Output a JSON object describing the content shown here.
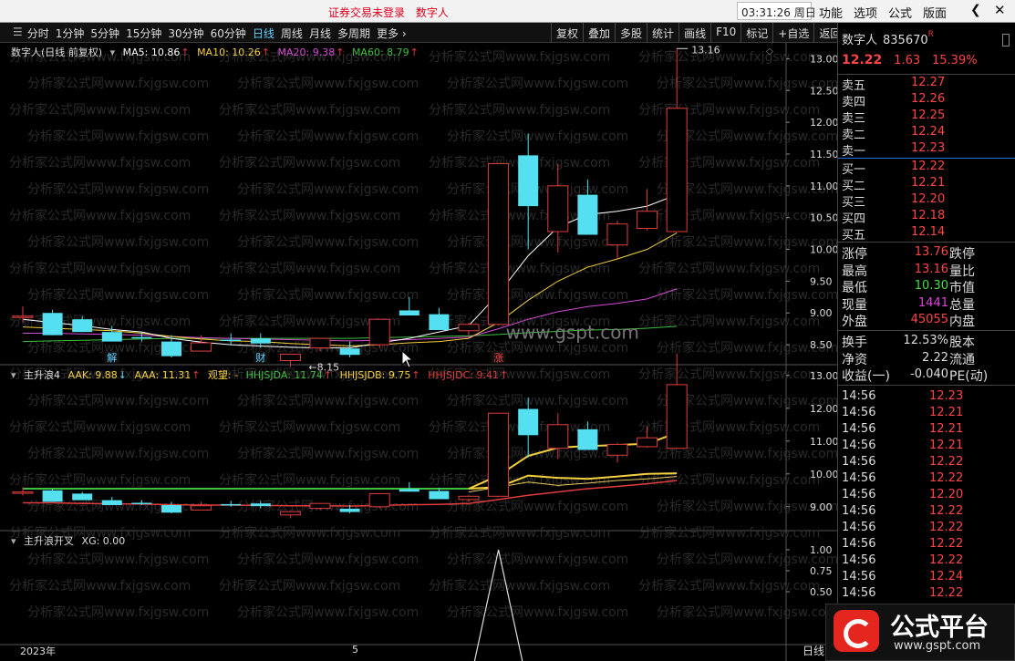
{
  "topbar": {
    "notice": "证券交易未登录",
    "stock_name": "数字人",
    "time": "03:31:26 周日",
    "menu": [
      "功能",
      "选项",
      "公式",
      "版面"
    ],
    "back_icon": "chevron-left-icon",
    "close_icon": "close-icon"
  },
  "toolbar": {
    "periods": [
      "分时",
      "1分钟",
      "5分钟",
      "15分钟",
      "30分钟",
      "60分钟",
      "日线",
      "周线",
      "月线",
      "多周期",
      "更多"
    ],
    "active_period": "日线",
    "tools": [
      "复权",
      "叠加",
      "多股",
      "统计",
      "画线",
      "F10",
      "标记",
      "+自选",
      "返回"
    ]
  },
  "main_panel": {
    "title": "数字人(日线 前复权)",
    "ma": [
      {
        "label": "MA5: 10.86",
        "color": "#ffffff"
      },
      {
        "label": "MA10: 10.26",
        "color": "#f4d03f"
      },
      {
        "label": "MA20: 9.38",
        "color": "#d24bd2"
      },
      {
        "label": "MA60: 8.79",
        "color": "#3fbf3f"
      }
    ],
    "annotations": {
      "high_label": "13.16",
      "low_label": "8.15",
      "watermark": "www.gspt.com",
      "marks": [
        "解",
        "财",
        "涨"
      ]
    }
  },
  "ind1_panel": {
    "title": "主升浪4",
    "items": [
      {
        "label": "AAK: 9.88",
        "color": "#f4d03f",
        "arrow": "↓"
      },
      {
        "label": "AAA: 11.31",
        "color": "#f4d03f",
        "arrow": "↑"
      },
      {
        "label": "观望: -",
        "color": "#f4d03f",
        "arrow": ""
      },
      {
        "label": "HHJSJDA: 11.74",
        "color": "#3fbf3f",
        "arrow": "↑"
      },
      {
        "label": "HHJSJDB: 9.75",
        "color": "#f4d03f",
        "arrow": "↑"
      },
      {
        "label": "HHJSJDC: 9.41",
        "color": "#e03c3c",
        "arrow": "↑"
      }
    ]
  },
  "ind2_panel": {
    "title": "主升浪开叉",
    "items": [
      {
        "label": "XG: 0.00",
        "color": "#dddddd"
      }
    ]
  },
  "x_axis": {
    "labels": [
      "2023年",
      "5"
    ]
  },
  "y_axis_main": [
    "13.00",
    "12.50",
    "12.00",
    "11.50",
    "11.00",
    "10.50",
    "10.00",
    "9.50",
    "9.00",
    "8.50"
  ],
  "y_axis_ind1": [
    "13.00",
    "12.00",
    "11.00",
    "10.00",
    "9.00"
  ],
  "y_axis_ind2": [
    "1.00",
    "0.75",
    "0.50"
  ],
  "chart_data": {
    "type": "candlestick",
    "ylim": [
      8.2,
      13.25
    ],
    "candles": [
      {
        "o": 8.95,
        "h": 9.1,
        "l": 8.85,
        "c": 8.95
      },
      {
        "o": 9.0,
        "h": 9.05,
        "l": 8.65,
        "c": 8.65
      },
      {
        "o": 8.9,
        "h": 8.95,
        "l": 8.7,
        "c": 8.7
      },
      {
        "o": 8.7,
        "h": 8.8,
        "l": 8.55,
        "c": 8.55
      },
      {
        "o": 8.62,
        "h": 8.7,
        "l": 8.55,
        "c": 8.6
      },
      {
        "o": 8.55,
        "h": 8.65,
        "l": 8.3,
        "c": 8.32
      },
      {
        "o": 8.4,
        "h": 8.65,
        "l": 8.4,
        "c": 8.53
      },
      {
        "o": 8.58,
        "h": 8.68,
        "l": 8.5,
        "c": 8.56
      },
      {
        "o": 8.6,
        "h": 8.68,
        "l": 8.45,
        "c": 8.52
      },
      {
        "o": 8.25,
        "h": 8.35,
        "l": 8.15,
        "c": 8.35
      },
      {
        "o": 8.45,
        "h": 8.6,
        "l": 8.4,
        "c": 8.6
      },
      {
        "o": 8.44,
        "h": 8.55,
        "l": 8.3,
        "c": 8.34
      },
      {
        "o": 8.5,
        "h": 8.9,
        "l": 8.45,
        "c": 8.9
      },
      {
        "o": 9.04,
        "h": 9.25,
        "l": 8.96,
        "c": 8.96
      },
      {
        "o": 8.98,
        "h": 9.08,
        "l": 8.73,
        "c": 8.73
      },
      {
        "o": 8.72,
        "h": 8.85,
        "l": 8.65,
        "c": 8.82
      },
      {
        "o": 8.82,
        "h": 11.35,
        "l": 8.8,
        "c": 11.35
      },
      {
        "o": 11.48,
        "h": 11.82,
        "l": 10.0,
        "c": 10.68
      },
      {
        "o": 10.28,
        "h": 11.35,
        "l": 9.95,
        "c": 11.0
      },
      {
        "o": 10.86,
        "h": 11.1,
        "l": 10.23,
        "c": 10.23
      },
      {
        "o": 10.07,
        "h": 10.45,
        "l": 9.85,
        "c": 10.4
      },
      {
        "o": 10.33,
        "h": 10.95,
        "l": 10.3,
        "c": 10.6
      },
      {
        "o": 10.28,
        "h": 13.16,
        "l": 10.28,
        "c": 12.22
      }
    ],
    "ma5": [
      8.9,
      8.85,
      8.8,
      8.74,
      8.7,
      8.6,
      8.54,
      8.5,
      8.48,
      8.46,
      8.45,
      8.45,
      8.53,
      8.6,
      8.7,
      8.8,
      9.3,
      9.9,
      10.35,
      10.55,
      10.6,
      10.68,
      10.86
    ],
    "ma10": [
      8.78,
      8.76,
      8.74,
      8.72,
      8.68,
      8.63,
      8.59,
      8.56,
      8.55,
      8.52,
      8.5,
      8.48,
      8.5,
      8.53,
      8.55,
      8.6,
      8.85,
      9.2,
      9.5,
      9.72,
      9.85,
      10.0,
      10.26
    ],
    "ma20": [
      8.68,
      8.68,
      8.67,
      8.66,
      8.65,
      8.63,
      8.61,
      8.6,
      8.59,
      8.58,
      8.57,
      8.56,
      8.57,
      8.58,
      8.6,
      8.62,
      8.75,
      8.9,
      9.02,
      9.1,
      9.15,
      9.22,
      9.38
    ],
    "ma60": [
      8.55,
      8.56,
      8.57,
      8.58,
      8.59,
      8.6,
      8.6,
      8.6,
      8.6,
      8.6,
      8.6,
      8.6,
      8.61,
      8.62,
      8.63,
      8.64,
      8.66,
      8.69,
      8.71,
      8.73,
      8.74,
      8.76,
      8.79
    ],
    "xg": [
      0,
      0,
      0,
      0,
      0,
      0,
      0,
      0,
      0,
      0,
      0,
      0,
      0,
      0,
      0,
      0,
      1,
      0,
      0,
      0,
      0,
      0,
      0
    ]
  },
  "sidebar": {
    "name": "数字人",
    "code": "835670",
    "flag": "R",
    "price": "12.22",
    "change": "1.63",
    "pct": "15.39%",
    "asks": [
      {
        "label": "卖五",
        "price": "12.27"
      },
      {
        "label": "卖四",
        "price": "12.26"
      },
      {
        "label": "卖三",
        "price": "12.25"
      },
      {
        "label": "卖二",
        "price": "12.24"
      },
      {
        "label": "卖一",
        "price": "12.23"
      }
    ],
    "bids": [
      {
        "label": "买一",
        "price": "12.22"
      },
      {
        "label": "买二",
        "price": "12.21"
      },
      {
        "label": "买三",
        "price": "12.20"
      },
      {
        "label": "买四",
        "price": "12.18"
      },
      {
        "label": "买五",
        "price": "12.14"
      }
    ],
    "stats": [
      {
        "a": "涨停",
        "b": "13.76",
        "c": "跌停",
        "color": "#ff4444"
      },
      {
        "a": "最高",
        "b": "13.16",
        "c": "量比",
        "color": "#ff4444"
      },
      {
        "a": "最低",
        "b": "10.30",
        "c": "市值",
        "color": "#44dd44"
      },
      {
        "a": "现量",
        "b": "1441",
        "c": "总量",
        "color": "#e040e0"
      },
      {
        "a": "外盘",
        "b": "45055",
        "c": "内盘",
        "color": "#ff4444"
      }
    ],
    "stats2": [
      {
        "a": "换手",
        "b": "12.53%",
        "c": "股本",
        "color": "#dddddd"
      },
      {
        "a": "净资",
        "b": "2.22",
        "c": "流通",
        "color": "#dddddd"
      },
      {
        "a": "收益(一)",
        "b": "-0.040",
        "c": "PE(动)",
        "color": "#dddddd"
      }
    ],
    "ticks": [
      {
        "t": "14:56",
        "p": "12.23"
      },
      {
        "t": "14:56",
        "p": "12.21"
      },
      {
        "t": "14:56",
        "p": "12.21"
      },
      {
        "t": "14:56",
        "p": "12.21"
      },
      {
        "t": "14:56",
        "p": "12.22"
      },
      {
        "t": "14:56",
        "p": "12.22"
      },
      {
        "t": "14:56",
        "p": "12.20"
      },
      {
        "t": "14:56",
        "p": "12.22"
      },
      {
        "t": "14:56",
        "p": "12.22"
      },
      {
        "t": "14:56",
        "p": "12.22"
      },
      {
        "t": "14:56",
        "p": "12.22"
      },
      {
        "t": "14:56",
        "p": "12.24"
      },
      {
        "t": "14:56",
        "p": "12.22"
      }
    ]
  },
  "logo": {
    "text": "公式平台",
    "url": "www.gspt.com"
  },
  "daily_tag": "日线",
  "watermark_text": "分析家公式网www.fxjgsw.com"
}
